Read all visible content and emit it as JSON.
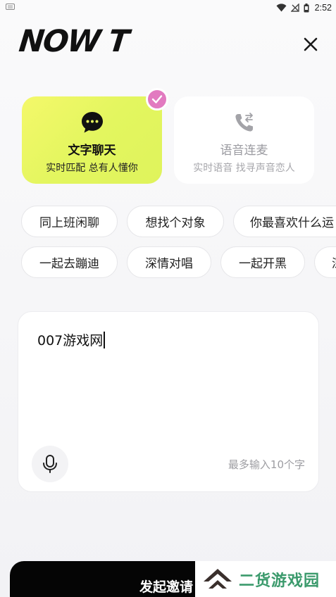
{
  "status_bar": {
    "time": "2:52"
  },
  "header": {
    "logo": "NOW T",
    "close_icon": "close-icon"
  },
  "modes": [
    {
      "title": "文字聊天",
      "subtitle": "实时匹配 总有人懂你",
      "icon": "chat-bubble-icon",
      "selected": true
    },
    {
      "title": "语音连麦",
      "subtitle": "实时语音 找寻声音恋人",
      "icon": "phone-transfer-icon",
      "selected": false
    }
  ],
  "tags": {
    "row1": [
      "同上班闲聊",
      "想找个对象",
      "你最喜欢什么运"
    ],
    "row2": [
      "一起去蹦迪",
      "深情对唱",
      "一起开黑",
      "深"
    ]
  },
  "input": {
    "value": "007游戏网",
    "limit_hint": "最多输入10个字"
  },
  "footer": {
    "invite_label": "发起邀请",
    "watermark": "二货游戏园"
  },
  "colors": {
    "selected_card": "#e6f65f",
    "badge": "#e27ac0",
    "button": "#050505"
  }
}
